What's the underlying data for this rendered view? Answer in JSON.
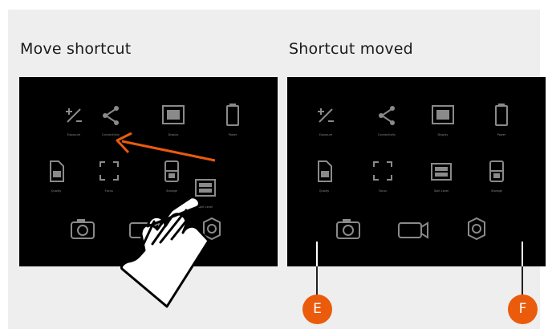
{
  "left_panel": {
    "title": "Move shortcut",
    "tiles": [
      {
        "label": "Exposure",
        "icon": "exposure-icon"
      },
      {
        "label": "Connectivity",
        "icon": "share-icon"
      },
      {
        "label": "Display",
        "icon": "display-icon"
      },
      {
        "label": "Power",
        "icon": "battery-icon"
      },
      {
        "label": "Quality",
        "icon": "file-icon"
      },
      {
        "label": "Focus",
        "icon": "focus-icon"
      },
      {
        "label": "Storage",
        "icon": "storage-icon"
      }
    ],
    "dragged_tile": {
      "label": "Split Level",
      "icon": "split-level-icon"
    },
    "bottom_icons": [
      "camera-icon",
      "video-icon",
      "gear-icon"
    ]
  },
  "right_panel": {
    "title": "Shortcut moved",
    "tiles": [
      {
        "label": "Exposure",
        "icon": "exposure-icon"
      },
      {
        "label": "Connectivity",
        "icon": "share-icon"
      },
      {
        "label": "Display",
        "icon": "display-icon"
      },
      {
        "label": "Power",
        "icon": "battery-icon"
      },
      {
        "label": "Quality",
        "icon": "file-icon"
      },
      {
        "label": "Focus",
        "icon": "focus-icon"
      },
      {
        "label": "Split Level",
        "icon": "split-level-icon"
      },
      {
        "label": "Storage",
        "icon": "storage-icon"
      }
    ],
    "bottom_icons": [
      "camera-icon",
      "video-icon",
      "gear-icon"
    ]
  },
  "callouts": {
    "e": "E",
    "f": "F"
  },
  "colors": {
    "accent": "#ea5b0c",
    "panel_bg": "#000000",
    "icon_gray": "#8a8a8a",
    "background": "#eeeeee"
  }
}
